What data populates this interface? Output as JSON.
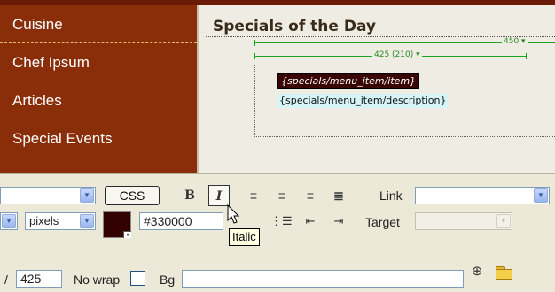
{
  "nav": {
    "items": [
      {
        "label": "Cuisine"
      },
      {
        "label": "Chef Ipsum"
      },
      {
        "label": "Articles"
      },
      {
        "label": "Special Events"
      }
    ]
  },
  "content": {
    "title": "Specials of the Day",
    "guide_outer_label": "450",
    "guide_inner_label": "425 (210)",
    "item_tag": "{specials/menu_item/item}",
    "separator": "-",
    "description_tag": "{specials/menu_item/description}"
  },
  "inspector": {
    "css_label": "CSS",
    "bold_label": "B",
    "italic_label": "I",
    "link_label": "Link",
    "units_value": "pixels",
    "color_value": "#330000",
    "color_swatch": "#330000",
    "target_label": "Target",
    "width_value": "425",
    "nowrap_label": "No wrap",
    "bg_label": "Bg",
    "tooltip": "Italic"
  },
  "icons": {
    "align_left": "align-left-icon",
    "align_center": "align-center-icon",
    "align_right": "align-right-icon",
    "justify": "justify-icon",
    "ordered_list": "ordered-list-icon",
    "outdent": "outdent-icon",
    "indent": "indent-icon",
    "point_to_file": "point-to-file-icon",
    "browse_folder": "folder-icon",
    "cursor": "mouse-cursor-icon"
  },
  "colors": {
    "nav_bg": "#8a2e0a",
    "guide": "#1aa51a",
    "item_tag_bg": "#3a0505",
    "description_tag_bg": "#d6f4f8"
  }
}
